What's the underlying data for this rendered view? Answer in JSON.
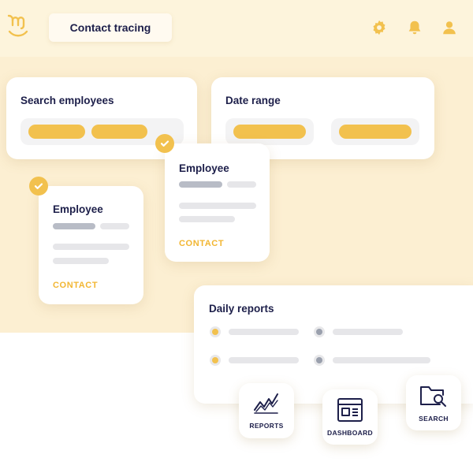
{
  "header": {
    "title": "Contact tracing",
    "logo_icon": "m-smile-logo-icon",
    "icons": [
      "gear-icon",
      "bell-icon",
      "user-icon"
    ]
  },
  "search_card": {
    "title": "Search employees",
    "filters": 2
  },
  "date_card": {
    "title": "Date range"
  },
  "employee_cards": [
    {
      "title": "Employee",
      "action": "CONTACT",
      "checked": true
    },
    {
      "title": "Employee",
      "action": "CONTACT",
      "checked": true
    }
  ],
  "daily_reports": {
    "title": "Daily reports",
    "dot_colors": [
      "#f2c14e",
      "#9aa0ad"
    ]
  },
  "tiles": [
    {
      "label": "REPORTS",
      "icon": "line-chart-icon"
    },
    {
      "label": "DASHBOARD",
      "icon": "dashboard-icon"
    },
    {
      "label": "SEARCH",
      "icon": "folder-search-icon"
    }
  ],
  "colors": {
    "accent": "#f2c14e",
    "navy": "#1d1f4a",
    "background": "#fcefd2"
  }
}
